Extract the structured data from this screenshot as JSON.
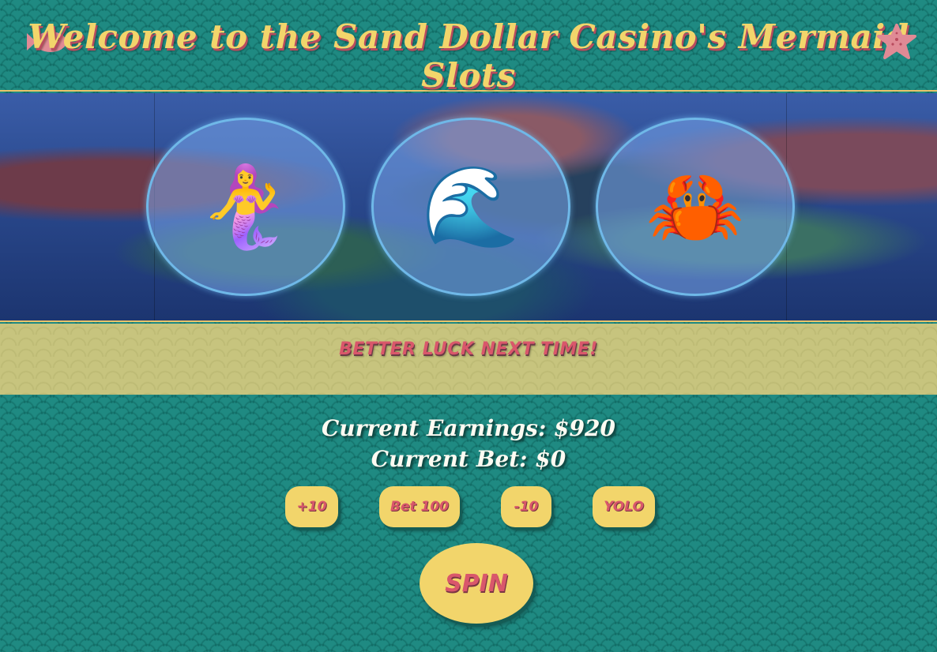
{
  "header": {
    "title": "Welcome to the Sand Dollar Casino's Mermaid Slots",
    "left_icon": "fish-icon",
    "right_icon": "starfish-icon"
  },
  "reels": [
    {
      "symbol": "🧜‍♀️",
      "name": "mermaid"
    },
    {
      "symbol": "🌊",
      "name": "wave"
    },
    {
      "symbol": "🦀",
      "name": "crab"
    }
  ],
  "message": "BETTER LUCK NEXT TIME!",
  "stats": {
    "earnings_label": "Current Earnings:",
    "earnings_value": "$920",
    "bet_label": "Current Bet:",
    "bet_value": "$0"
  },
  "buttons": {
    "plus10": "+10",
    "bet100": "Bet 100",
    "minus10": "-10",
    "yolo": "YOLO",
    "spin": "SPIN"
  },
  "colors": {
    "teal": "#1f8a82",
    "gold": "#f2d56b",
    "pink": "#d9576b",
    "sand": "#c7c47e"
  }
}
